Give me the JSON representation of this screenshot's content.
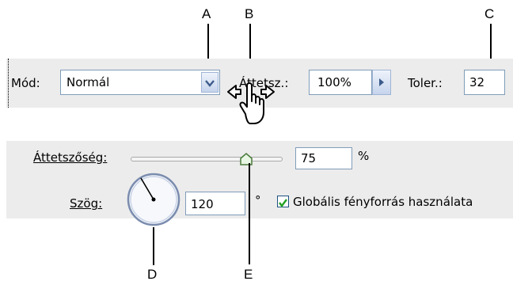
{
  "callouts": {
    "a": "A",
    "b": "B",
    "c": "C",
    "d": "D",
    "e": "E"
  },
  "options_bar": {
    "mode_label": "Mód:",
    "mode_value": "Normál",
    "opacity_label": "Áttetsz.:",
    "opacity_value": "100%",
    "tolerance_label": "Toler.:",
    "tolerance_value": "32"
  },
  "panel": {
    "opacity_label": "Áttetszőség:",
    "opacity_value": "75",
    "opacity_unit": "%",
    "opacity_slider_level": 0.75,
    "angle_label": "Szög:",
    "angle_value": "120",
    "angle_unit": "°",
    "global_light_label": "Globális fényforrás használata",
    "global_light_checked": true
  },
  "icons": [
    "chevron-down-icon",
    "triangle-right-icon",
    "scrubby-hand-cursor-icon",
    "checkmark-icon",
    "angle-dial-icon",
    "slider-thumb-icon"
  ]
}
